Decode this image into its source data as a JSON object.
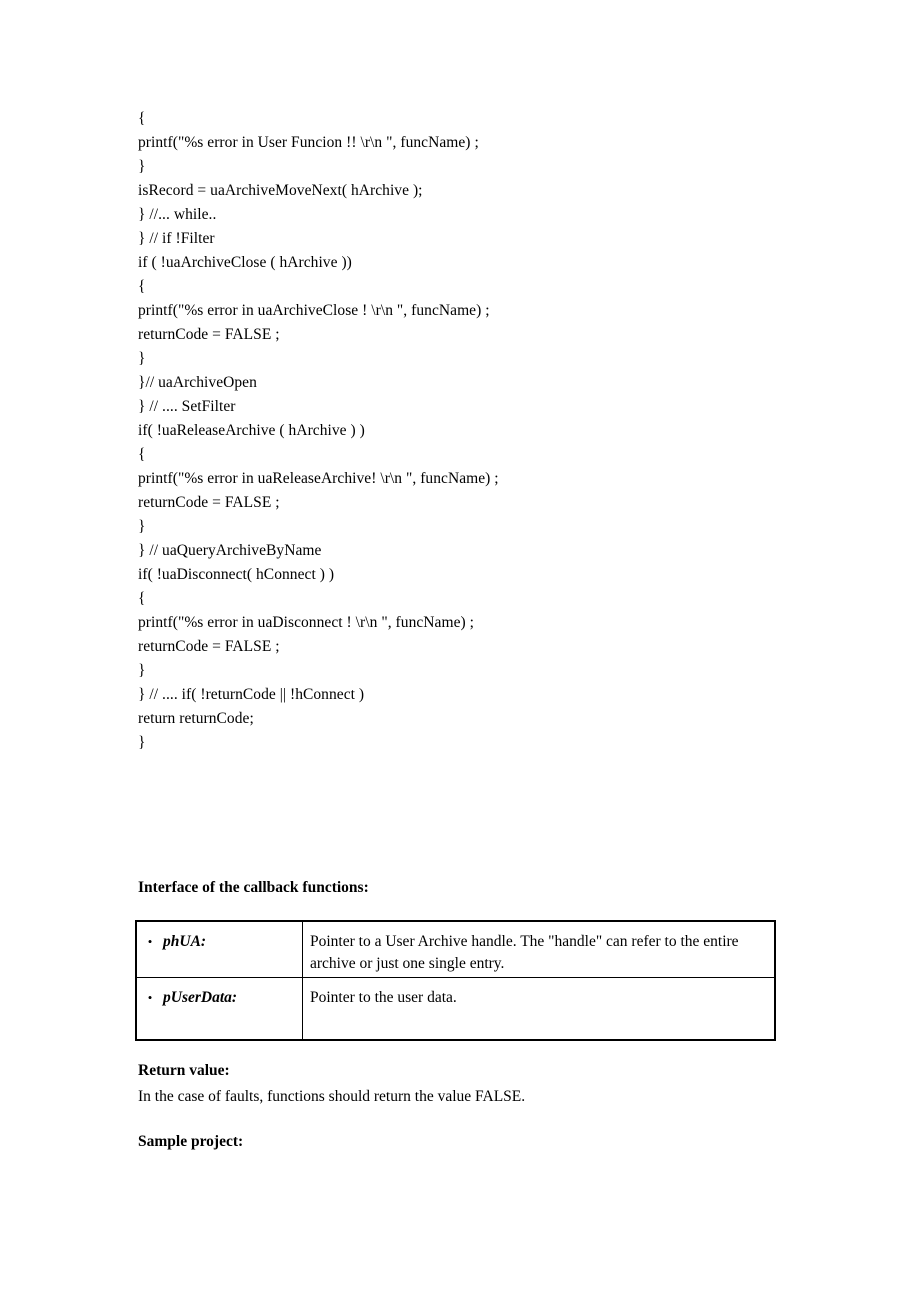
{
  "document": {
    "code_block": {
      "lines": [
        "{",
        "printf(\"%s error in User Funcion !! \\r\\n \", funcName) ;",
        "}",
        "isRecord = uaArchiveMoveNext( hArchive );",
        "} //... while..",
        "} // if !Filter",
        "if ( !uaArchiveClose ( hArchive ))",
        "{",
        "printf(\"%s error in uaArchiveClose ! \\r\\n \", funcName) ;",
        "returnCode = FALSE ;",
        "}",
        "}// uaArchiveOpen",
        "} // .... SetFilter",
        "if( !uaReleaseArchive ( hArchive ) )",
        "{",
        "printf(\"%s error in uaReleaseArchive! \\r\\n \", funcName) ;",
        "returnCode = FALSE ;",
        "}",
        "} // uaQueryArchiveByName",
        "if( !uaDisconnect( hConnect ) )",
        "{",
        "printf(\"%s error in uaDisconnect ! \\r\\n \", funcName) ;",
        "returnCode = FALSE ;",
        "}",
        "} // .... if( !returnCode || !hConnect )",
        "return returnCode;",
        "}"
      ]
    },
    "headings": {
      "callback_interface": "Interface of the callback functions:",
      "return_value": "Return value:",
      "sample_project": "Sample project:"
    },
    "return_value_text": "In the case of faults, functions should return the value FALSE.",
    "parameter_table": {
      "bullet_glyph": "•",
      "rows": [
        {
          "name": "phUA:",
          "description": "Pointer to a User Archive handle. The \"handle\" can refer to the entire archive or just one single entry."
        },
        {
          "name": "pUserData:",
          "description": "Pointer to the user data."
        }
      ]
    }
  }
}
